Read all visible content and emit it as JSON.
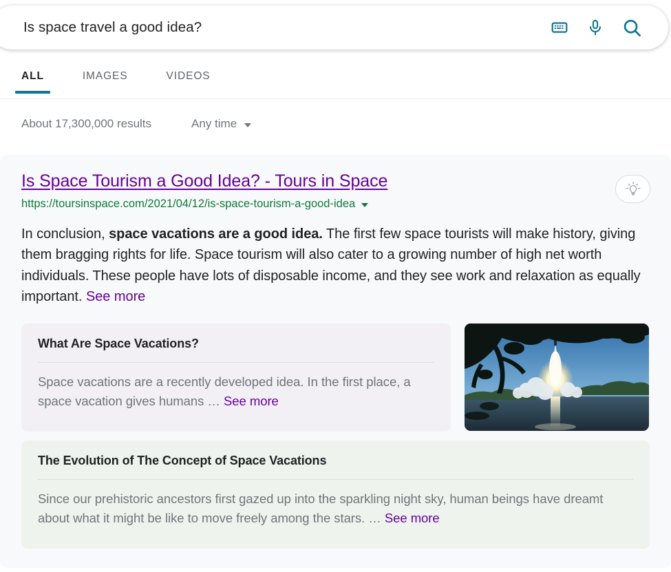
{
  "search": {
    "query": "Is space travel a good idea?",
    "placeholder": "Search",
    "keyboard_icon": "keyboard-icon",
    "mic_icon": "microphone-icon",
    "search_icon": "search-icon",
    "accent_color": "#0d7490"
  },
  "tabs": [
    {
      "label": "ALL",
      "active": true
    },
    {
      "label": "IMAGES",
      "active": false
    },
    {
      "label": "VIDEOS",
      "active": false
    }
  ],
  "meta": {
    "result_count": "About 17,300,000 results",
    "time_filter": "Any time",
    "caret_icon": "chevron-down-icon"
  },
  "result": {
    "title": "Is Space Tourism a Good Idea? - Tours in Space",
    "url": "https://toursinspace.com/2021/04/12/is-space-tourism-a-good-idea",
    "url_caret_icon": "chevron-down-icon",
    "bulb_icon": "lightbulb-icon",
    "title_color": "#660099",
    "url_color": "#0e7a3c",
    "snippet": {
      "lead": "In conclusion, ",
      "bold": "space vacations are a good idea.",
      "rest": " The first few space tourists will make history, giving them bragging rights for life. Space tourism will also cater to a growing number of high net worth individuals. These people have lots of disposable income, and they see work and relaxation as equally important. ",
      "see_more": "See more"
    },
    "thumbnail_alt": "rocket-launch-photo"
  },
  "subcards": [
    {
      "title": "What Are Space Vacations?",
      "body": "Space vacations are a recently developed idea. In the first place, a space vacation gives humans … ",
      "see_more": "See more",
      "bg_color": "#f2f0f4"
    },
    {
      "title": "The Evolution of The Concept of Space Vacations",
      "body": "Since our prehistoric ancestors first gazed up into the sparkling night sky, human beings have dreamt about what it might be like to move freely among the stars. … ",
      "see_more": "See more",
      "bg_color": "#eef3ee"
    }
  ]
}
